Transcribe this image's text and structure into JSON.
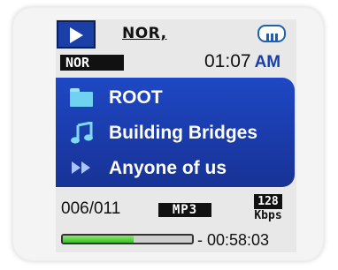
{
  "status_bar": {
    "play_state_icon": "play-icon",
    "eq_mode_top": "NOR,",
    "battery_icon": "battery-full-icon",
    "eq_mode_badge": "NOR",
    "time": "01:07",
    "ampm": "AM"
  },
  "browser": {
    "items": [
      {
        "icon": "folder-icon",
        "label": "ROOT"
      },
      {
        "icon": "music-note-icon",
        "label": "Building Bridges"
      },
      {
        "icon": "fast-forward-icon",
        "label": "Anyone of us"
      }
    ],
    "highlight_color": "#1e48c4"
  },
  "playback": {
    "track_counter": "006/011",
    "format": "MP3",
    "bitrate_value": "128",
    "bitrate_unit": "Kbps",
    "progress_fraction": 0.55,
    "remaining_time": "- 00:58:03",
    "progress_color": "#3cbf2a"
  }
}
